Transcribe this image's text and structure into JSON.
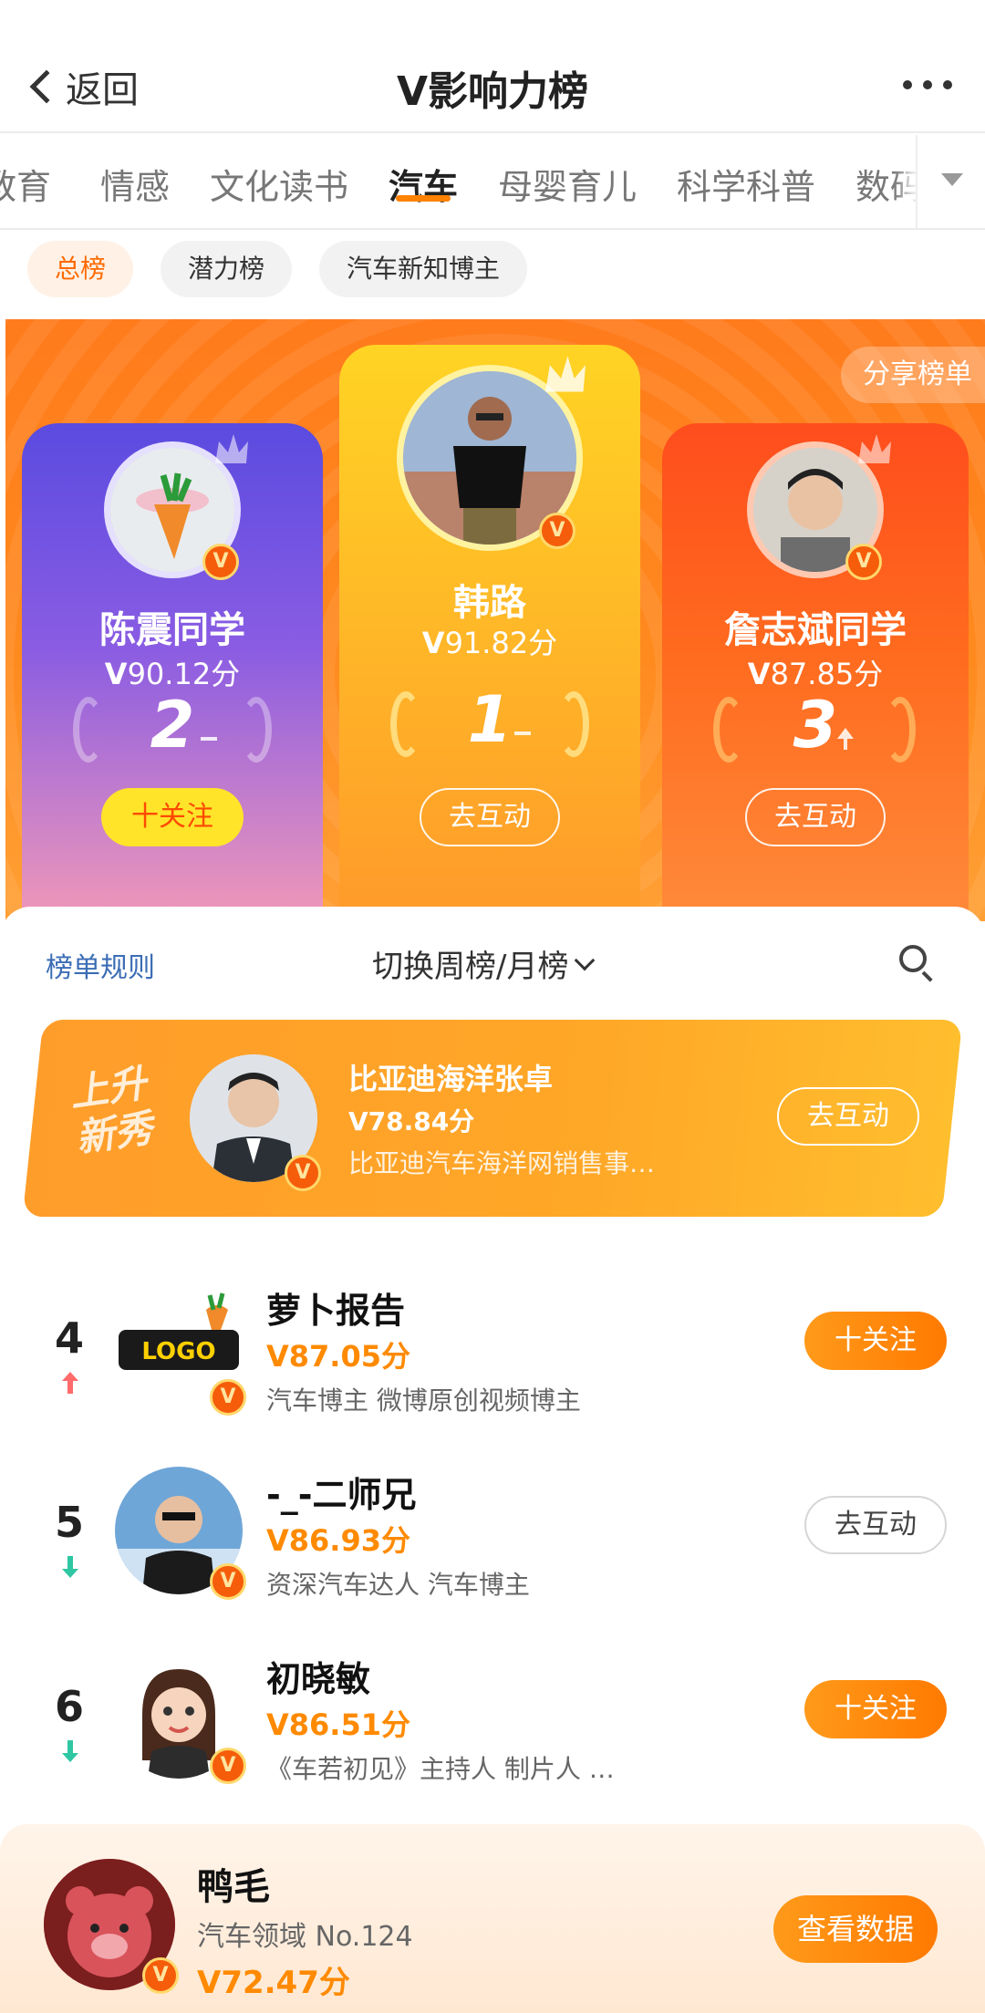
{
  "header": {
    "back_label": "返回",
    "title": "V影响力榜"
  },
  "tabs": [
    "教育",
    "情感",
    "文化读书",
    "汽车",
    "母婴育儿",
    "科学科普",
    "数码"
  ],
  "active_tab": "汽车",
  "subtabs": [
    "总榜",
    "潜力榜",
    "汽车新知博主"
  ],
  "active_subtab": "总榜",
  "share_label": "分享榜单",
  "podium": {
    "first": {
      "name": "韩路",
      "score": "91.82分",
      "rank": "1",
      "trend": "flat",
      "button": "去互动"
    },
    "second": {
      "name": "陈震同学",
      "score": "90.12分",
      "rank": "2",
      "trend": "flat",
      "button": "十关注"
    },
    "third": {
      "name": "詹志斌同学",
      "score": "87.85分",
      "rank": "3",
      "trend": "up",
      "button": "去互动"
    }
  },
  "panel": {
    "rules": "榜单规则",
    "switch_label": "切换周榜/月榜"
  },
  "rising": {
    "tag_line1": "上升",
    "tag_line2": "新秀",
    "name": "比亚迪海洋张卓",
    "score": "78.84分",
    "desc": "比亚迪汽车海洋网销售事…",
    "button": "去互动"
  },
  "list": [
    {
      "rank": "4",
      "trend": "up",
      "name": "萝卜报告",
      "score": "87.05分",
      "desc": "汽车博主 微博原创视频博主",
      "button": "十关注",
      "button_style": "filled"
    },
    {
      "rank": "5",
      "trend": "down",
      "name": "-_-二师兄",
      "score": "86.93分",
      "desc": "资深汽车达人 汽车博主",
      "button": "去互动",
      "button_style": "outline"
    },
    {
      "rank": "6",
      "trend": "down",
      "name": "初晓敏",
      "score": "86.51分",
      "desc": "《车若初见》主持人 制片人 …",
      "button": "十关注",
      "button_style": "filled"
    }
  ],
  "me": {
    "name": "鸭毛",
    "rank_text": "汽车领域 No.124",
    "score": "72.47分",
    "button": "查看数据"
  },
  "colors": {
    "accent": "#ff8200",
    "score_orange": "#ff8a00",
    "link_blue": "#3b6db5",
    "trend_up": "#ff6b6b",
    "trend_down": "#2fc7a3"
  }
}
